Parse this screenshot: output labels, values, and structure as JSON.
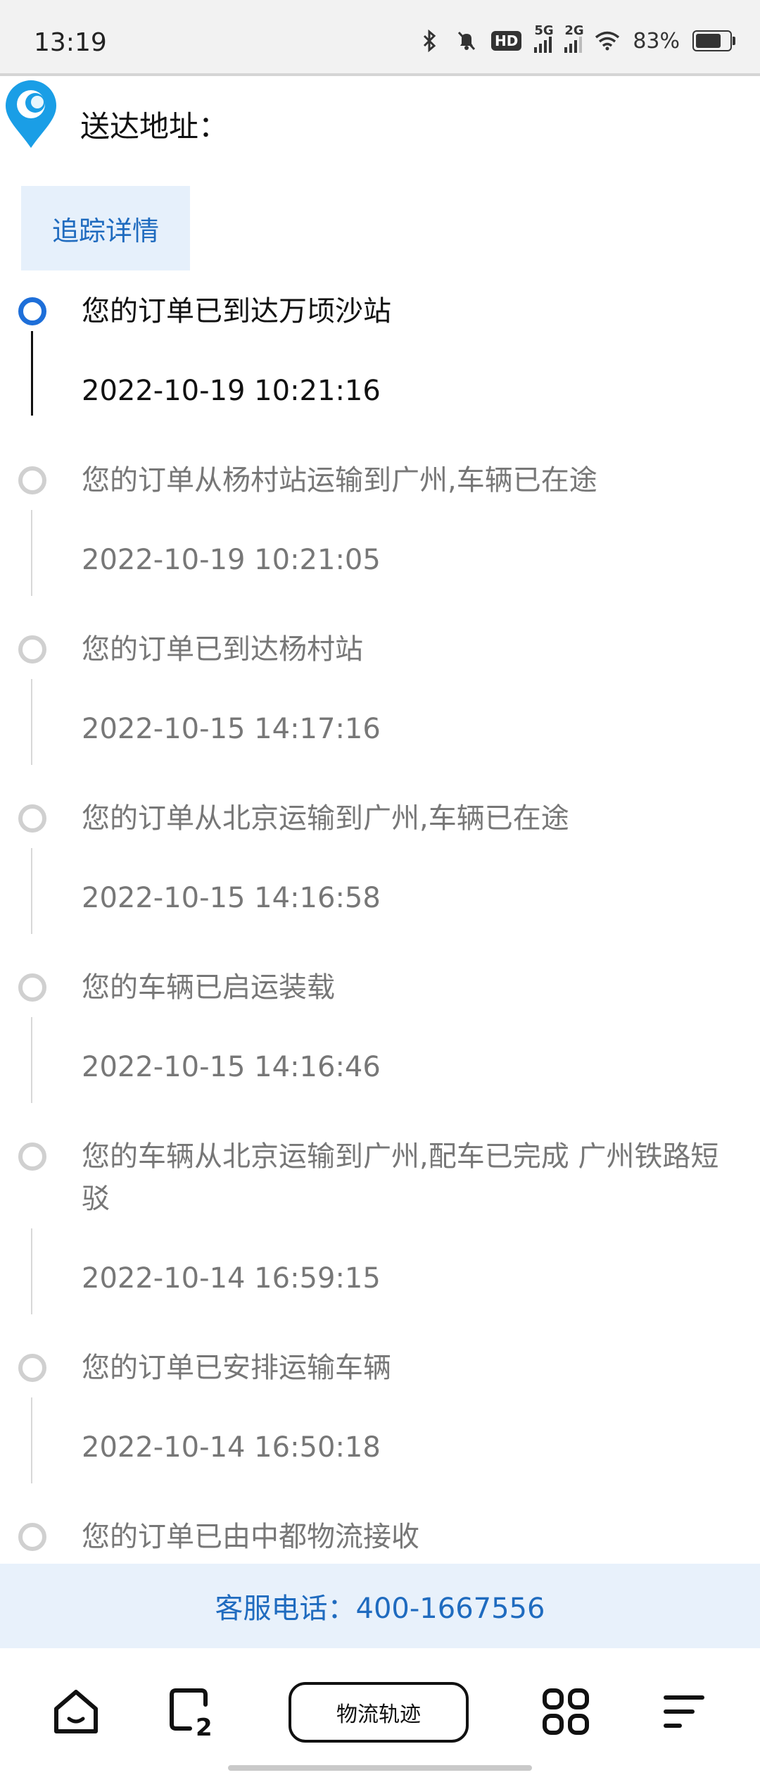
{
  "status_bar": {
    "time": "13:19",
    "network_1": "5G",
    "network_2": "2G",
    "battery_percent": "83%",
    "battery_level": 0.83,
    "icons": [
      "bluetooth-icon",
      "mute-icon",
      "hd-icon",
      "signal-icon",
      "wifi-icon",
      "battery-icon"
    ]
  },
  "header": {
    "address_label": "送达地址："
  },
  "tabs": {
    "tracking_label": "追踪详情"
  },
  "timeline": [
    {
      "text": "您的订单已到达万顷沙站",
      "time": "2022-10-19 10:21:16",
      "active": true
    },
    {
      "text": "您的订单从杨村站运输到广州,车辆已在途",
      "time": "2022-10-19 10:21:05",
      "active": false
    },
    {
      "text": "您的订单已到达杨村站",
      "time": "2022-10-15 14:17:16",
      "active": false
    },
    {
      "text": "您的订单从北京运输到广州,车辆已在途",
      "time": "2022-10-15 14:16:58",
      "active": false
    },
    {
      "text": "您的车辆已启运装载",
      "time": "2022-10-15 14:16:46",
      "active": false
    },
    {
      "text": "您的车辆从北京运输到广州,配车已完成 广州铁路短驳",
      "time": "2022-10-14 16:59:15",
      "active": false
    },
    {
      "text": "您的订单已安排运输车辆",
      "time": "2022-10-14 16:50:18",
      "active": false
    },
    {
      "text": "您的订单已由中都物流接收",
      "time": "",
      "active": false
    }
  ],
  "service": {
    "text": "客服电话：400-1667556"
  },
  "bottom_nav": {
    "center_label": "物流轨迹",
    "icons": [
      "home-icon",
      "recent-apps-icon",
      "apps-grid-icon",
      "menu-icon"
    ]
  },
  "colors": {
    "accent": "#1e6fd9",
    "service_bg": "#e8f1fb",
    "muted_text": "#777777"
  }
}
